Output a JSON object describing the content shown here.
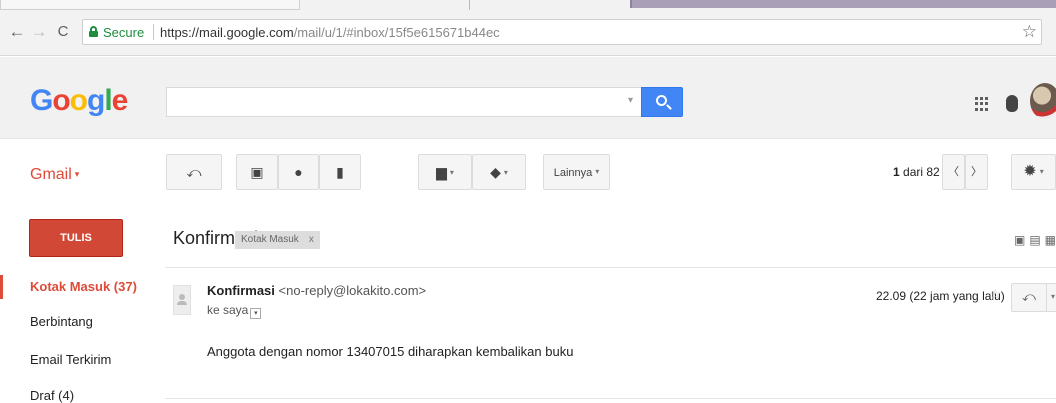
{
  "browser": {
    "secure_label": "Secure",
    "url_host": "https://mail.google.com",
    "url_path": "/mail/u/1/#inbox/15f5e615671b44ec",
    "back_icon": "←",
    "forward_icon": "→",
    "reload_icon": "C",
    "bookmark_icon": "☆"
  },
  "header": {
    "logo_letters": [
      "G",
      "o",
      "o",
      "g",
      "l",
      "e"
    ],
    "search_caret": "▾"
  },
  "toolbar": {
    "gmail_label": "Gmail",
    "gmail_dropdown": "▾",
    "reply_icon": "⤺",
    "archive_icon": "▣",
    "spam_icon": "●",
    "delete_icon": "▮",
    "folder_icon": "▆",
    "label_icon": "◆",
    "dropdown_small": "▾",
    "more_label": "Lainnya",
    "pager_current": "1",
    "pager_text": "dari 82",
    "prev_icon": "〈",
    "next_icon": "〉",
    "settings_icon": "✹"
  },
  "sidebar": {
    "compose_label": "TULIS",
    "items": [
      {
        "label": "Kotak Masuk (37)"
      },
      {
        "label": "Berbintang"
      },
      {
        "label": "Email Terkirim"
      },
      {
        "label": "Draf (4)"
      }
    ]
  },
  "thread": {
    "subject": "Konfirmasi",
    "label_chip": "Kotak Masuk",
    "label_remove": "x",
    "header_icons": "▣▤▦",
    "sender_name": "Konfirmasi",
    "sender_email": "<no-reply@lokakito.com>",
    "to_text": "ke saya",
    "to_dropdown": "▾",
    "date": "22.09 (22 jam yang lalu)",
    "star_icon": "☆",
    "reply_icon": "⤺",
    "more_icon": "▾",
    "body": "Anggota dengan nomor 13407015 diharapkan kembalikan buku"
  }
}
